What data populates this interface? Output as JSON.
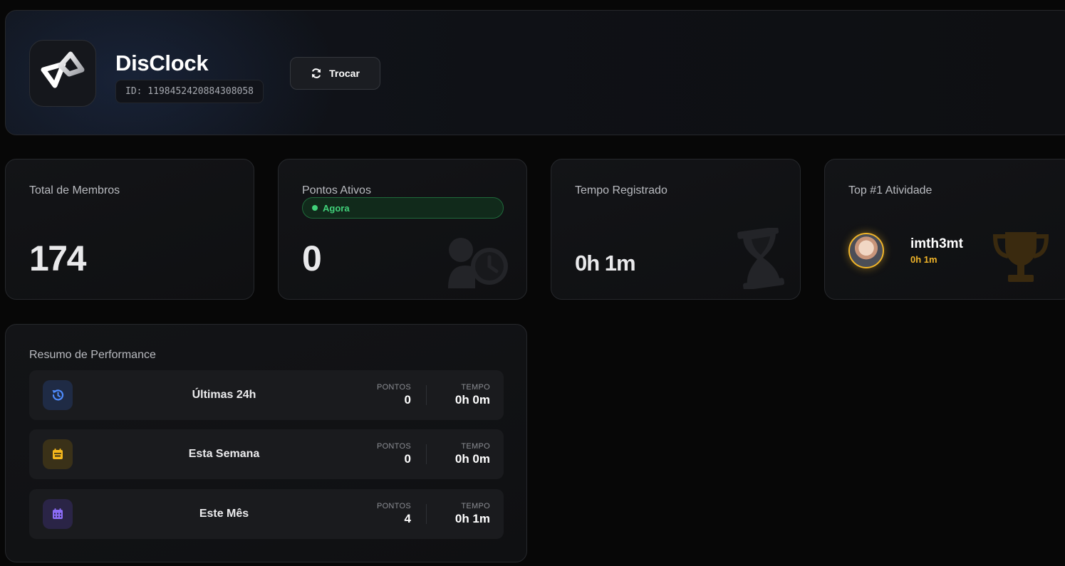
{
  "header": {
    "app_name": "DisClock",
    "server_id": "ID: 1198452420884308058",
    "swap_label": "Trocar"
  },
  "stats": {
    "members": {
      "label": "Total de Membros",
      "value": "174"
    },
    "active_points": {
      "label": "Pontos Ativos",
      "badge": "Agora",
      "value": "0"
    },
    "time_logged": {
      "label": "Tempo Registrado",
      "value": "0h 1m"
    },
    "top_activity": {
      "label": "Top #1 Atividade",
      "user": "imth3mt",
      "time": "0h 1m"
    }
  },
  "performance": {
    "title": "Resumo de Performance",
    "points_label": "PONTOS",
    "time_label": "TEMPO",
    "rows": [
      {
        "label": "Últimas 24h",
        "points": "0",
        "time": "0h 0m",
        "icon": "history-icon"
      },
      {
        "label": "Esta Semana",
        "points": "0",
        "time": "0h 0m",
        "icon": "calendar-week-icon"
      },
      {
        "label": "Este Mês",
        "points": "4",
        "time": "0h 1m",
        "icon": "calendar-month-icon"
      }
    ]
  },
  "colors": {
    "background": "#070707",
    "card": "#131417",
    "live_green": "#41d17a",
    "gold": "#f0b429",
    "blue_icon": "#4f8cff",
    "yellow_icon": "#f5b81c",
    "purple_icon": "#8b6cf6"
  }
}
